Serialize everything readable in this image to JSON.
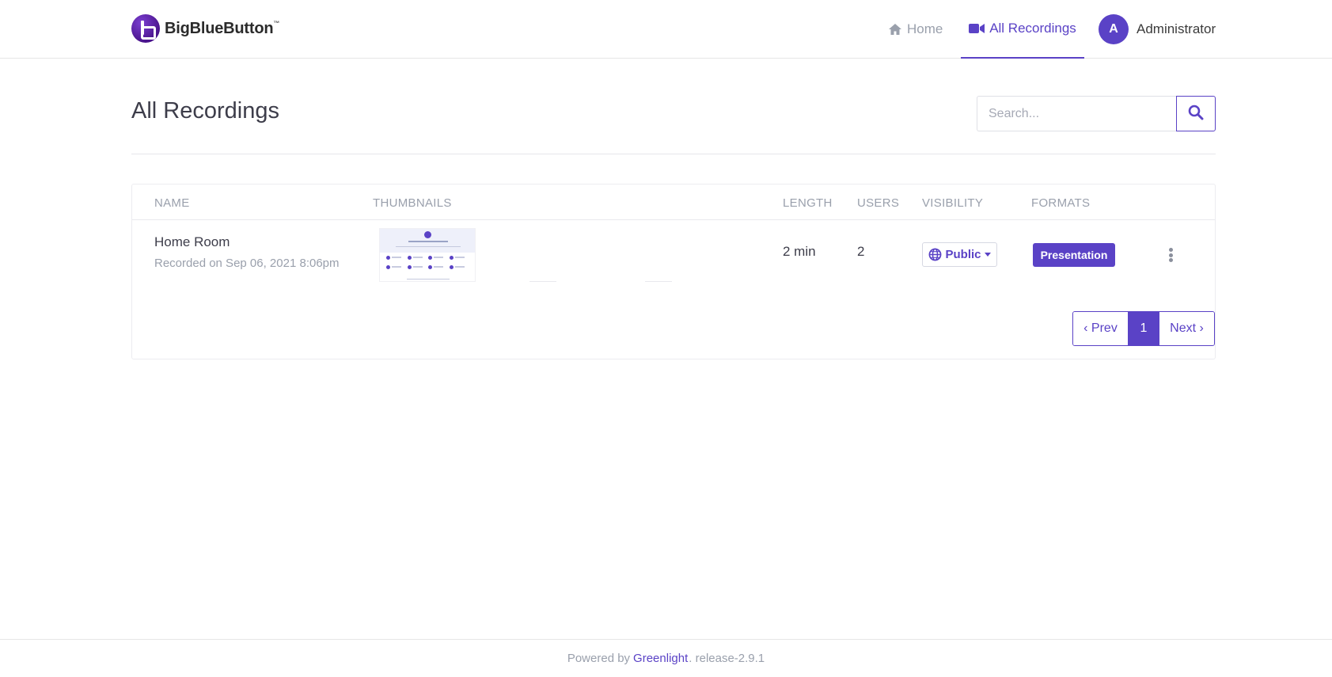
{
  "brand": {
    "name": "BigBlueButton",
    "tm": "™"
  },
  "nav": {
    "home_label": "Home",
    "home_icon": "home-icon",
    "recordings_label": "All Recordings",
    "recordings_icon": "video-camera-icon",
    "user_initial": "A",
    "user_name": "Administrator"
  },
  "page": {
    "title": "All Recordings",
    "search_placeholder": "Search..."
  },
  "table": {
    "headers": [
      "NAME",
      "THUMBNAILS",
      "LENGTH",
      "USERS",
      "VISIBILITY",
      "FORMATS"
    ],
    "rows": [
      {
        "name": "Home Room",
        "recorded": "Recorded on Sep 06, 2021 8:06pm",
        "length": "2 min",
        "users": "2",
        "visibility": "Public",
        "format": "Presentation"
      }
    ]
  },
  "pagination": {
    "prev": "‹ Prev",
    "current": "1",
    "next": "Next ›"
  },
  "footer": {
    "prefix": "Powered by",
    "link": "Greenlight",
    "suffix": ". release-2.9.1"
  },
  "colors": {
    "accent": "#5a42c6",
    "muted": "#9aa0ac",
    "text": "#3d3d4a"
  }
}
